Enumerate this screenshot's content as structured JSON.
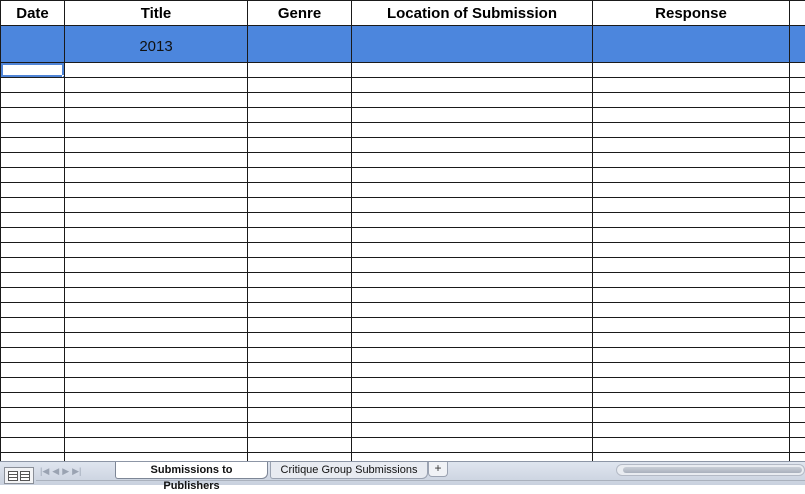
{
  "sheet": {
    "headers": [
      "Date",
      "Title",
      "Genre",
      "Location of Submission",
      "Response"
    ],
    "year_label": "2013"
  },
  "tabs": {
    "active": "Submissions to Publishers",
    "inactive": "Critique Group Submissions",
    "add_symbol": "+"
  },
  "colors": {
    "highlight_row": "#4c86dd",
    "selection": "#4f84d6"
  },
  "icons": {
    "view_toggle": "grid-view-icon",
    "nav": [
      "first-sheet-icon",
      "prev-sheet-icon",
      "next-sheet-icon",
      "last-sheet-icon"
    ]
  }
}
